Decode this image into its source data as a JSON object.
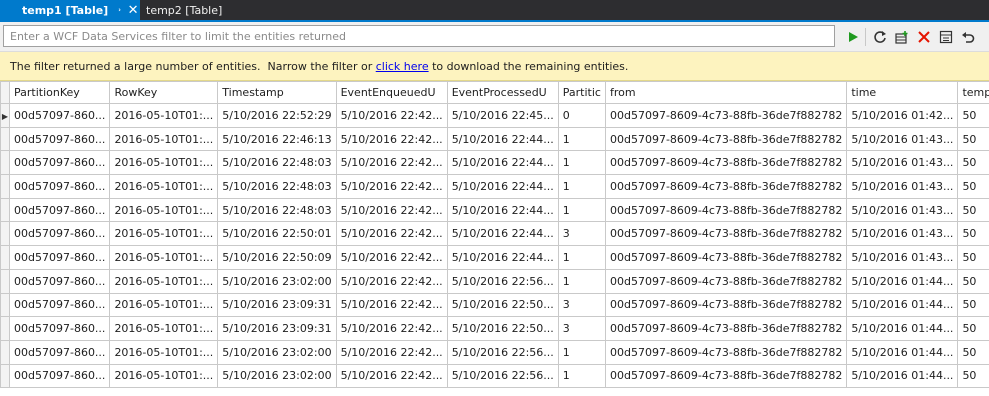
{
  "tabs": [
    {
      "label": "temp1 [Table]",
      "active": true,
      "pin_icon": "pin-icon",
      "close_icon": "close-icon"
    },
    {
      "label": "temp2 [Table]",
      "active": false
    }
  ],
  "filter": {
    "placeholder": "Enter a WCF Data Services filter to limit the entities returned",
    "value": ""
  },
  "toolbar": {
    "icons": [
      "run-query-icon",
      "refresh-icon",
      "add-entity-icon",
      "delete-entity-icon",
      "view-entity-icon",
      "undo-icon"
    ]
  },
  "info": {
    "text_before": "The filter returned a large number of entities.  Narrow the filter or ",
    "link": "click here",
    "text_after": " to download the remaining entities."
  },
  "columns": [
    "PartitionKey",
    "RowKey",
    "Timestamp",
    "EventEnqueuedU",
    "EventProcessedU",
    "Partitic",
    "from",
    "time",
    "temp"
  ],
  "rows": [
    [
      "00d57097-860...",
      "2016-05-10T01:...",
      "5/10/2016 22:52:29",
      "5/10/2016 22:42...",
      "5/10/2016 22:45...",
      "0",
      "00d57097-8609-4c73-88fb-36de7f882782",
      "5/10/2016 01:42...",
      "50"
    ],
    [
      "00d57097-860...",
      "2016-05-10T01:...",
      "5/10/2016 22:46:13",
      "5/10/2016 22:42...",
      "5/10/2016 22:44...",
      "1",
      "00d57097-8609-4c73-88fb-36de7f882782",
      "5/10/2016 01:43...",
      "50"
    ],
    [
      "00d57097-860...",
      "2016-05-10T01:...",
      "5/10/2016 22:48:03",
      "5/10/2016 22:42...",
      "5/10/2016 22:44...",
      "1",
      "00d57097-8609-4c73-88fb-36de7f882782",
      "5/10/2016 01:43...",
      "50"
    ],
    [
      "00d57097-860...",
      "2016-05-10T01:...",
      "5/10/2016 22:48:03",
      "5/10/2016 22:42...",
      "5/10/2016 22:44...",
      "1",
      "00d57097-8609-4c73-88fb-36de7f882782",
      "5/10/2016 01:43...",
      "50"
    ],
    [
      "00d57097-860...",
      "2016-05-10T01:...",
      "5/10/2016 22:48:03",
      "5/10/2016 22:42...",
      "5/10/2016 22:44...",
      "1",
      "00d57097-8609-4c73-88fb-36de7f882782",
      "5/10/2016 01:43...",
      "50"
    ],
    [
      "00d57097-860...",
      "2016-05-10T01:...",
      "5/10/2016 22:50:01",
      "5/10/2016 22:42...",
      "5/10/2016 22:44...",
      "3",
      "00d57097-8609-4c73-88fb-36de7f882782",
      "5/10/2016 01:43...",
      "50"
    ],
    [
      "00d57097-860...",
      "2016-05-10T01:...",
      "5/10/2016 22:50:09",
      "5/10/2016 22:42...",
      "5/10/2016 22:44...",
      "1",
      "00d57097-8609-4c73-88fb-36de7f882782",
      "5/10/2016 01:43...",
      "50"
    ],
    [
      "00d57097-860...",
      "2016-05-10T01:...",
      "5/10/2016 23:02:00",
      "5/10/2016 22:42...",
      "5/10/2016 22:56...",
      "1",
      "00d57097-8609-4c73-88fb-36de7f882782",
      "5/10/2016 01:44...",
      "50"
    ],
    [
      "00d57097-860...",
      "2016-05-10T01:...",
      "5/10/2016 23:09:31",
      "5/10/2016 22:42...",
      "5/10/2016 22:50...",
      "3",
      "00d57097-8609-4c73-88fb-36de7f882782",
      "5/10/2016 01:44...",
      "50"
    ],
    [
      "00d57097-860...",
      "2016-05-10T01:...",
      "5/10/2016 23:09:31",
      "5/10/2016 22:42...",
      "5/10/2016 22:50...",
      "3",
      "00d57097-8609-4c73-88fb-36de7f882782",
      "5/10/2016 01:44...",
      "50"
    ],
    [
      "00d57097-860...",
      "2016-05-10T01:...",
      "5/10/2016 23:02:00",
      "5/10/2016 22:42...",
      "5/10/2016 22:56...",
      "1",
      "00d57097-8609-4c73-88fb-36de7f882782",
      "5/10/2016 01:44...",
      "50"
    ],
    [
      "00d57097-860...",
      "2016-05-10T01:...",
      "5/10/2016 23:02:00",
      "5/10/2016 22:42...",
      "5/10/2016 22:56...",
      "1",
      "00d57097-8609-4c73-88fb-36de7f882782",
      "5/10/2016 01:44...",
      "50"
    ]
  ],
  "current_row_icon": "current-row-arrow-icon",
  "colors": {
    "tab_active": "#007acc",
    "tab_strip": "#2d2d30",
    "info_bar": "#fdf3bf",
    "link": "#0000ee"
  }
}
